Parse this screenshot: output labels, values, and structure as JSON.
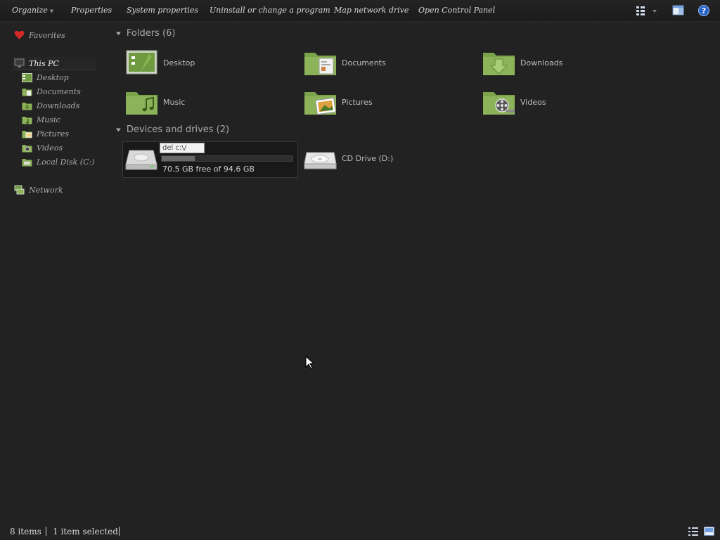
{
  "toolbar": {
    "organize": "Organize",
    "properties": "Properties",
    "system_properties": "System properties",
    "uninstall": "Uninstall or change a program",
    "map_drive": "Map network drive",
    "control_panel": "Open Control Panel"
  },
  "nav": {
    "favorites": "Favorites",
    "this_pc": "This PC",
    "items": [
      "Desktop",
      "Documents",
      "Downloads",
      "Music",
      "Pictures",
      "Videos",
      "Local Disk (C:)"
    ],
    "network": "Network"
  },
  "content": {
    "folders_header": "Folders (6)",
    "folders": [
      "Desktop",
      "Documents",
      "Downloads",
      "Music",
      "Pictures",
      "Videos"
    ],
    "drives_header": "Devices and drives (2)",
    "local_disk": {
      "rename_text": "del c:\\/",
      "free_text": "70.5 GB free of 94.6 GB",
      "used_fraction": 0.2548
    },
    "cd_drive": "CD Drive (D:)"
  },
  "status": {
    "item_count": "8 items",
    "selected": "1 item selected"
  },
  "colors": {
    "background": "#222222",
    "folder_green": "#8db35a"
  }
}
